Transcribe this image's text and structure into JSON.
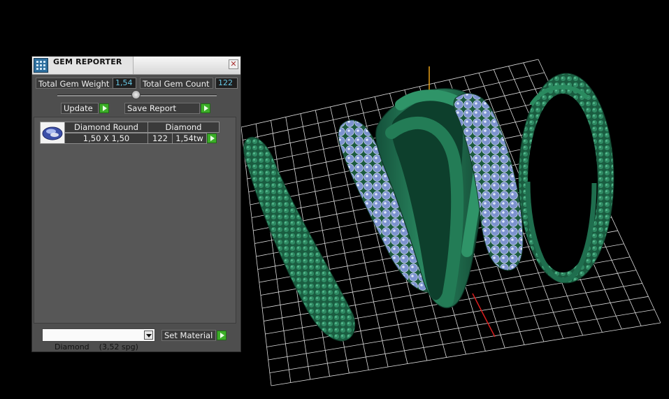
{
  "panel": {
    "title": "GEM REPORTER",
    "close_glyph": "✕",
    "total_gem_weight_label": "Total Gem Weight",
    "total_gem_weight_value": "1,54",
    "total_gem_count_label": "Total Gem Count",
    "total_gem_count_value": "122",
    "update_label": "Update",
    "save_report_label": "Save Report",
    "gem_list": [
      {
        "cut": "Diamond Round",
        "material": "Diamond",
        "size": "1,50 X 1,50",
        "count": "122",
        "weight": "1,54tw",
        "icon": "gem-thumbnail-icon"
      }
    ],
    "material_select_value": "Diamond    (3,52 spg)",
    "set_material_label": "Set Material"
  },
  "viewport": {
    "content": "3d-ring-render",
    "ring_color": "#1f6e4e",
    "gem_color": "#8aa0d8",
    "grid_color": "#e6e6e6",
    "x_axis_color": "#d81e1e",
    "y_axis_color": "#e8a018",
    "z_axis_color": "#2aa0c8"
  },
  "colors": {
    "panel_bg": "#4e4e4e",
    "value_text": "#67c9e6",
    "arrow_button": "#3cae28"
  }
}
